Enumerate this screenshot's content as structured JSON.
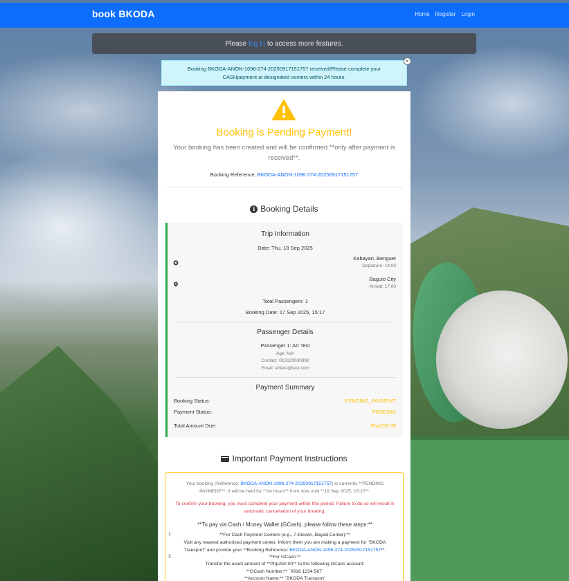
{
  "navbar": {
    "brand": "book BKODA",
    "links": [
      "Home",
      "Register",
      "Login"
    ]
  },
  "login_notice": {
    "before": "Please",
    "link": "log in",
    "after": "to access more features."
  },
  "alert": {
    "text": "Booking BKODA-ANON-1096-274-20250917151757 received!Please complete your CASHpayment at designated centers within 24 hours.",
    "close": "×"
  },
  "status": {
    "title": "Booking is Pending Payment!",
    "lead": "Your booking has been created and will be confirmed **only after payment is received**.",
    "ref_label": "Booking Reference:",
    "ref_value": "BKODA-ANON-1096-274-20250917151757"
  },
  "details": {
    "heading": "Booking Details",
    "trip": {
      "heading": "Trip Information",
      "date": "Date: Thu, 18 Sep 2025",
      "origin": "Kabayan, Benguet",
      "departure": "Departure: 14:00",
      "destination": "Baguio City",
      "arrival": "Arrival: 17:00",
      "total_passengers": "Total Passengers: 1",
      "booking_date": "Booking Date: 17 Sep 2025, 15:17"
    },
    "passenger": {
      "heading": "Passenger Details",
      "name": "Passenger 1: Art Test",
      "age": "Age: N/A",
      "contact": "Contact: 015120030892",
      "email": "Email: arttest@test.com"
    },
    "payment": {
      "heading": "Payment Summary",
      "booking_status_label": "Booking Status:",
      "booking_status_value": "PENDING_PAYMENT",
      "payment_status_label": "Payment Status:",
      "payment_status_value": "PENDING",
      "total_label": "Total Amount Due:",
      "total_value": "Php250.00"
    }
  },
  "instructions": {
    "heading": "Important Payment Instructions",
    "p1_a": "Your booking (Reference:",
    "p1_ref": "BKODA-ANON-1096-274-20250917151757",
    "p1_b": ") is currently **PENDING PAYMENT**. It will be held for **24 hours** from now until **18 Sep 2025, 15:17**.",
    "p2": "To confirm your booking, you must complete your payment within this period. Failure to do so will result in automatic cancellation of your booking.",
    "steps_heading": "**To pay via Cash / Money Wallet (GCash), please follow these steps:**",
    "step1_num": "1.",
    "step1_title": "**For Cash Payment Centers (e.g., 7-Eleven, Bayad Center):**",
    "step1_a": "Visit any nearest authorized payment center. Inform them you are making a payment for \"BKODA Transport\" and provide your **Booking Reference:",
    "step1_ref": "BKODA-ANON-1096-274-20250917151757",
    "step1_b": "**.",
    "step2_num": "2.",
    "step2_title": "**For GCash:**",
    "step2_a": "Transfer the exact amount of **Php250.00** to the following GCash account:",
    "step2_b": "**GCash Number:** `0916 1234 567`",
    "step2_c": "**Account Name:** `BKODA Transport`"
  },
  "colors": {
    "primary": "#0d6efd",
    "warning": "#ffc107",
    "success": "#28a745",
    "danger": "#dc3545"
  }
}
